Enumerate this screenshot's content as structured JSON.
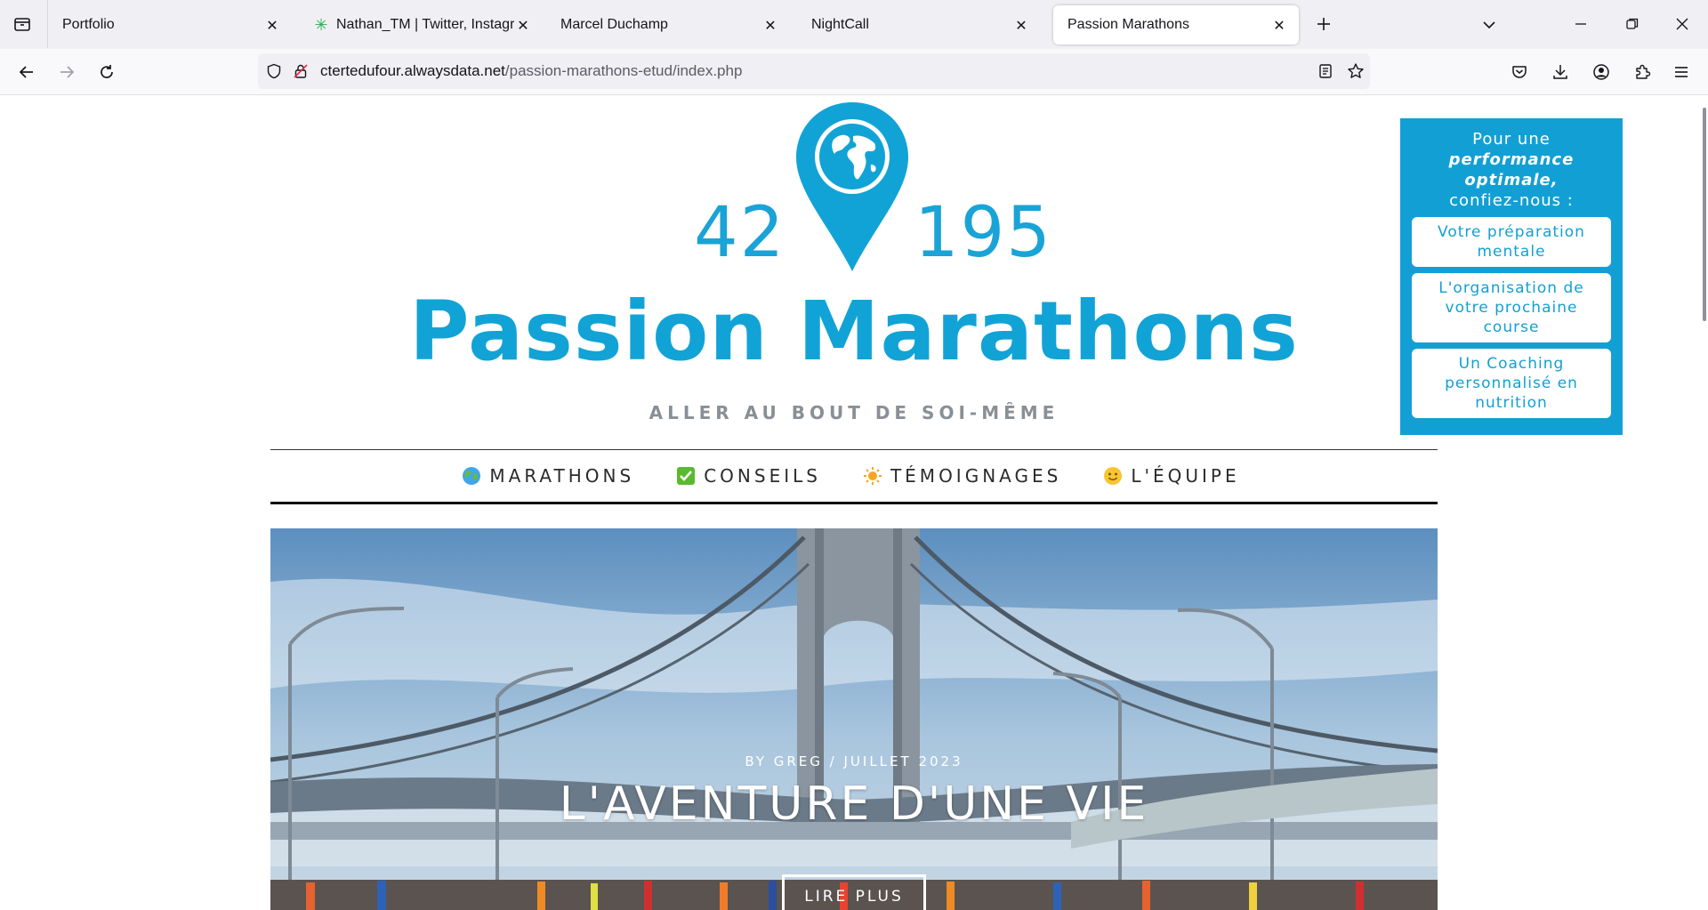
{
  "browser": {
    "tabs": [
      {
        "title": "Portfolio",
        "active": false
      },
      {
        "title": "Nathan_TM | Twitter, Instagram",
        "active": false
      },
      {
        "title": "Marcel Duchamp",
        "active": false
      },
      {
        "title": "NightCall",
        "active": false
      },
      {
        "title": "Passion Marathons",
        "active": true
      }
    ],
    "url": {
      "host": "ctertedufour.alwaysdata.net",
      "path": "/passion-marathons-etud/index.php"
    }
  },
  "site": {
    "logo": {
      "left_number": "42",
      "right_number": "195"
    },
    "brand": "Passion Marathons",
    "tagline": "ALLER AU BOUT DE SOI-MÊME",
    "menu": [
      {
        "label": "MARATHONS",
        "icon": "globe-icon"
      },
      {
        "label": "CONSEILS",
        "icon": "check-mark-icon"
      },
      {
        "label": "TÉMOIGNAGES",
        "icon": "sun-icon"
      },
      {
        "label": "L'ÉQUIPE",
        "icon": "smiley-icon"
      }
    ],
    "hero": {
      "meta": "BY GREG / JUILLET 2023",
      "title": "L'AVENTURE D'UNE VIE",
      "button": "LIRE PLUS"
    },
    "sidebox": {
      "intro_line1": "Pour une",
      "intro_emphasis": "performance optimale,",
      "intro_line2": "confiez-nous :",
      "links": [
        "Votre préparation mentale",
        "L'organisation de votre prochaine course",
        "Un Coaching personnalisé en nutrition"
      ]
    },
    "colors": {
      "brand_blue": "#12a3d6",
      "tagline_gray": "#8a8f95"
    }
  }
}
